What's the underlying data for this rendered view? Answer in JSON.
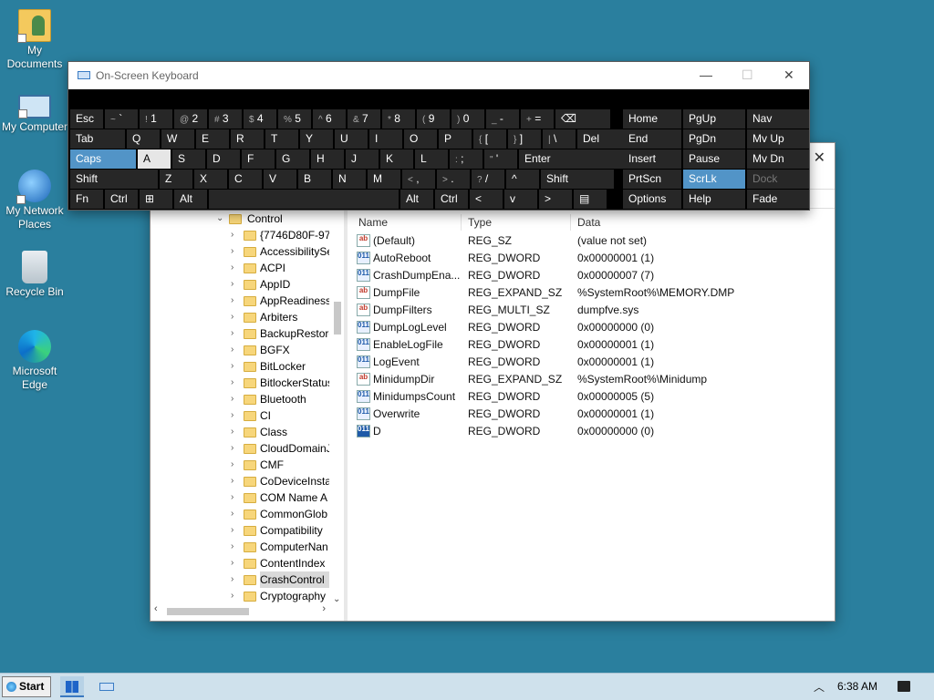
{
  "desktop": {
    "icons": [
      {
        "label": "My\nDocuments"
      },
      {
        "label": "My Computer"
      },
      {
        "label": "My Network\nPlaces"
      },
      {
        "label": "Recycle Bin"
      },
      {
        "label": "Microsoft\nEdge"
      }
    ]
  },
  "osk": {
    "title": "On-Screen Keyboard",
    "rows": [
      [
        {
          "main": "Esc"
        },
        {
          "main": "`",
          "sub": "~"
        },
        {
          "main": "1",
          "sub": "!"
        },
        {
          "main": "2",
          "sub": "@"
        },
        {
          "main": "3",
          "sub": "#"
        },
        {
          "main": "4",
          "sub": "$"
        },
        {
          "main": "5",
          "sub": "%"
        },
        {
          "main": "6",
          "sub": "^"
        },
        {
          "main": "7",
          "sub": "&"
        },
        {
          "main": "8",
          "sub": "*"
        },
        {
          "main": "9",
          "sub": "("
        },
        {
          "main": "0",
          "sub": ")"
        },
        {
          "main": "-",
          "sub": "_"
        },
        {
          "main": "=",
          "sub": "+"
        },
        {
          "main": "⌫"
        }
      ],
      [
        {
          "main": "Tab"
        },
        {
          "main": "Q"
        },
        {
          "main": "W"
        },
        {
          "main": "E"
        },
        {
          "main": "R"
        },
        {
          "main": "T"
        },
        {
          "main": "Y"
        },
        {
          "main": "U"
        },
        {
          "main": "I"
        },
        {
          "main": "O"
        },
        {
          "main": "P"
        },
        {
          "main": "[",
          "sub": "{"
        },
        {
          "main": "]",
          "sub": "}"
        },
        {
          "main": "\\",
          "sub": "|"
        },
        {
          "main": "Del"
        }
      ],
      [
        {
          "main": "Caps",
          "state": "hi"
        },
        {
          "main": "A",
          "state": "lt"
        },
        {
          "main": "S"
        },
        {
          "main": "D"
        },
        {
          "main": "F"
        },
        {
          "main": "G"
        },
        {
          "main": "H"
        },
        {
          "main": "J"
        },
        {
          "main": "K"
        },
        {
          "main": "L"
        },
        {
          "main": ";",
          "sub": ":"
        },
        {
          "main": "'",
          "sub": "\""
        },
        {
          "main": "Enter"
        }
      ],
      [
        {
          "main": "Shift"
        },
        {
          "main": "Z"
        },
        {
          "main": "X"
        },
        {
          "main": "C"
        },
        {
          "main": "V"
        },
        {
          "main": "B"
        },
        {
          "main": "N"
        },
        {
          "main": "M"
        },
        {
          "main": ",",
          "sub": "<"
        },
        {
          "main": ".",
          "sub": ">"
        },
        {
          "main": "/",
          "sub": "?"
        },
        {
          "main": "^"
        },
        {
          "main": "Shift"
        }
      ],
      [
        {
          "main": "Fn"
        },
        {
          "main": "Ctrl"
        },
        {
          "main": "⊞"
        },
        {
          "main": "Alt"
        },
        {
          "main": ""
        },
        {
          "main": "Alt"
        },
        {
          "main": "Ctrl"
        },
        {
          "main": "<"
        },
        {
          "main": "v"
        },
        {
          "main": ">"
        },
        {
          "main": "▤"
        }
      ]
    ],
    "nav": [
      [
        "Home",
        "PgUp",
        "Nav"
      ],
      [
        "End",
        "PgDn",
        "Mv Up"
      ],
      [
        "Insert",
        "Pause",
        "Mv Dn"
      ],
      [
        "PrtScn",
        "ScrLk",
        "Dock"
      ],
      [
        "Options",
        "Help",
        "Fade"
      ]
    ]
  },
  "regedit": {
    "tree": {
      "root": "Control",
      "items": [
        "{7746D80F-97E",
        "AccessibilitySe",
        "ACPI",
        "AppID",
        "AppReadiness",
        "Arbiters",
        "BackupRestore",
        "BGFX",
        "BitLocker",
        "BitlockerStatus",
        "Bluetooth",
        "CI",
        "Class",
        "CloudDomainJ",
        "CMF",
        "CoDeviceInsta",
        "COM Name A",
        "CommonGlob",
        "Compatibility",
        "ComputerNan",
        "ContentIndex",
        "CrashControl",
        "Cryptography"
      ],
      "selected": "CrashControl"
    },
    "columns": [
      "Name",
      "Type",
      "Data"
    ],
    "values": [
      {
        "icon": "sz",
        "name": "(Default)",
        "type": "REG_SZ",
        "data": "(value not set)"
      },
      {
        "icon": "bin",
        "name": "AutoReboot",
        "type": "REG_DWORD",
        "data": "0x00000001 (1)"
      },
      {
        "icon": "bin",
        "name": "CrashDumpEna...",
        "type": "REG_DWORD",
        "data": "0x00000007 (7)"
      },
      {
        "icon": "sz",
        "name": "DumpFile",
        "type": "REG_EXPAND_SZ",
        "data": "%SystemRoot%\\MEMORY.DMP"
      },
      {
        "icon": "sz",
        "name": "DumpFilters",
        "type": "REG_MULTI_SZ",
        "data": "dumpfve.sys"
      },
      {
        "icon": "bin",
        "name": "DumpLogLevel",
        "type": "REG_DWORD",
        "data": "0x00000000 (0)"
      },
      {
        "icon": "bin",
        "name": "EnableLogFile",
        "type": "REG_DWORD",
        "data": "0x00000001 (1)"
      },
      {
        "icon": "bin",
        "name": "LogEvent",
        "type": "REG_DWORD",
        "data": "0x00000001 (1)"
      },
      {
        "icon": "sz",
        "name": "MinidumpDir",
        "type": "REG_EXPAND_SZ",
        "data": "%SystemRoot%\\Minidump"
      },
      {
        "icon": "bin",
        "name": "MinidumpsCount",
        "type": "REG_DWORD",
        "data": "0x00000005 (5)"
      },
      {
        "icon": "bin",
        "name": "Overwrite",
        "type": "REG_DWORD",
        "data": "0x00000001 (1)"
      },
      {
        "icon": "bin-blue",
        "name": "D",
        "type": "REG_DWORD",
        "data": "0x00000000 (0)"
      }
    ]
  },
  "taskbar": {
    "start_label": "Start",
    "clock": "6:38 AM"
  }
}
